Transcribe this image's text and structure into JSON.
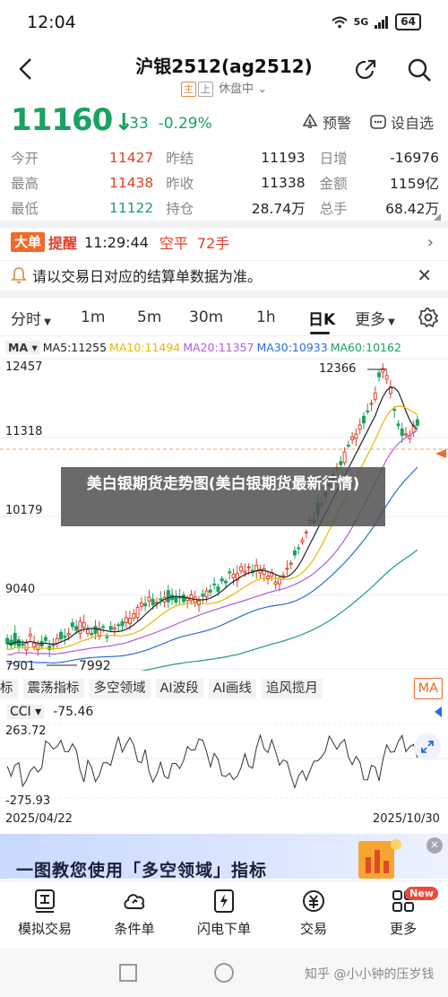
{
  "status_bar": {
    "time": "12:04",
    "signal": "5G",
    "battery": "64"
  },
  "header": {
    "title": "沪银2512(ag2512)",
    "tag_main": "主",
    "tag_exchange": "上",
    "market_status": "休盘中"
  },
  "quote": {
    "price": "11160",
    "arrow": "↓",
    "change": "-33",
    "change_pct": "-0.29%",
    "alert_label": "预警",
    "custom_label": "设自选"
  },
  "stats": [
    {
      "l1": "今开",
      "v1": "11427",
      "l2": "昨结",
      "v2": "11193",
      "l3": "日增",
      "v3": "-16976"
    },
    {
      "l1": "最高",
      "v1": "11438",
      "l2": "昨收",
      "v2": "11338",
      "l3": "金额",
      "v3": "1159亿"
    },
    {
      "l1": "最低",
      "v1": "11122",
      "l2": "持仓",
      "v2": "28.74万",
      "l3": "总手",
      "v3": "68.42万"
    }
  ],
  "big_order": {
    "badge": "大单",
    "label": "提醒",
    "time": "11:29:44",
    "type": "空平",
    "qty": "72手"
  },
  "notice": {
    "text": "请以交易日对应的结算单数据为准。"
  },
  "tabs": [
    "分时",
    "1m",
    "5m",
    "30m",
    "1h",
    "日K",
    "更多"
  ],
  "ma_legend": {
    "label": "MA",
    "ma5": "MA5:11255",
    "ma10": "MA10:11494",
    "ma20": "MA20:11357",
    "ma30": "MA30:10933",
    "ma60": "MA60:10162"
  },
  "colors": {
    "up": "#e0402a",
    "down": "#1aa260",
    "ma5": "#222222",
    "ma10": "#e8b800",
    "ma20": "#b05cd6",
    "ma30": "#2b6be0",
    "ma60": "#1aa260",
    "accent": "#f06a28"
  },
  "chart_axis": {
    "y_top": "12457",
    "y2": "11318",
    "y3": "10179",
    "y4": "9040",
    "y_bottom": "7901",
    "high_label": "12366",
    "low_label": "7992"
  },
  "watermark_text": "美白银期货走势图(美白银期货最新行情)",
  "indicator_tabs": [
    "标",
    "震荡指标",
    "多空领域",
    "AI波段",
    "AI画线",
    "追风揽月"
  ],
  "indicator_active": "MA",
  "cci": {
    "label": "CCI",
    "value": "-75.46",
    "top": "263.72",
    "bottom": "-275.93"
  },
  "dates": {
    "start": "2025/04/22",
    "end": "2025/10/30"
  },
  "banner": {
    "text": "一图教您使用「多空领域」指标"
  },
  "bottom_nav": [
    {
      "label": "模拟交易",
      "icon": "sim-trade-icon"
    },
    {
      "label": "条件单",
      "icon": "condition-order-icon"
    },
    {
      "label": "闪电下单",
      "icon": "flash-order-icon"
    },
    {
      "label": "交易",
      "icon": "trade-icon"
    },
    {
      "label": "更多",
      "icon": "more-grid-icon",
      "badge": "New"
    }
  ],
  "footer_watermark": "知乎 @小小钟的压岁钱"
}
